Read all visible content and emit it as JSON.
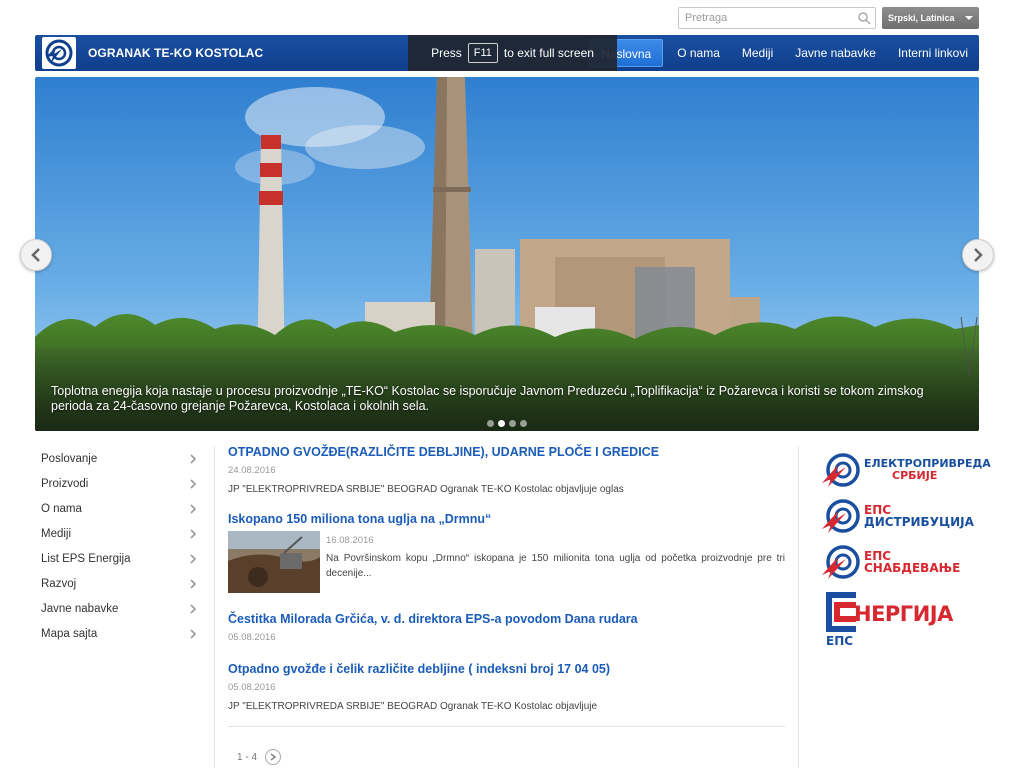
{
  "search": {
    "placeholder": "Pretraga"
  },
  "language": {
    "selected": "Srpski, Latinica"
  },
  "header": {
    "title": "OGRANAK TE-KO KOSTOLAC",
    "nav": [
      "Naslovna",
      "O nama",
      "Mediji",
      "Javne nabavke",
      "Interni linkovi"
    ],
    "active_index": 0
  },
  "fullscreen_notice": {
    "press": "Press",
    "key": "F11",
    "message": "to exit full screen"
  },
  "slider": {
    "caption": "Toplotna enegija koja nastaje u procesu proizvodnje „TE-KO“ Kostolac se isporučuje Javnom Preduzeću „Toplifikacija“ iz Požarevca i koristi se tokom zimskog perioda za 24-časovno grejanje Požarevca, Kostolaca i okolnih sela.",
    "slide_count": 4,
    "active_slide": 2
  },
  "sidebar": {
    "items": [
      "Poslovanje",
      "Proizvodi",
      "O nama",
      "Mediji",
      "List EPS Energija",
      "Razvoj",
      "Javne nabavke",
      "Mapa sajta"
    ]
  },
  "news": [
    {
      "title": "OTPADNO GVOŽĐE(RAZLIČITE DEBLJINE), UDARNE PLOČE I GREDICE",
      "date": "24.08.2016",
      "text": "JP \"ELEKTROPRIVREDA SRBIJE\" BEOGRAD Ogranak TE-KO Kostolac objavljuje oglas"
    },
    {
      "title": "Iskopano 150 miliona tona uglja na „Drmnu“",
      "date": "16.08.2016",
      "text": "Na Površinskom kopu „Drmno“ iskopana je 150 milionita tona uglja od početka proizvodnje pre tri decenije..."
    },
    {
      "title": "Čestitka Milorada Grčića, v. d. direktora EPS-a povodom Dana rudara",
      "date": "05.08.2016",
      "text": ""
    },
    {
      "title": "Otpadno gvožđe i čelik različite debljine ( indeksni broj 17 04 05)",
      "date": "05.08.2016",
      "text": "JP \"ELEKTROPRIVREDA SRBIJE\" BEOGRAD Ogranak TE-KO Kostolac objavljuje"
    }
  ],
  "pager": {
    "range": "1 - 4"
  },
  "brands": [
    {
      "line1": "ЕЛЕКТРОПРИВРЕДА",
      "line2": "СРБИЈЕ"
    },
    {
      "line1": "ЕПС",
      "line2": "ДИСТРИБУЦИЈА"
    },
    {
      "line1": "ЕПС",
      "line2": "СНАБДЕВАЊЕ"
    }
  ],
  "energija": {
    "big": "НЕРГИЈА",
    "small": "ЕПС"
  },
  "colors": {
    "brand_blue": "#0f3f8d",
    "accent_blue": "#1f6fd6",
    "link_blue": "#1a5cb8",
    "eps_red": "#d7282f"
  }
}
